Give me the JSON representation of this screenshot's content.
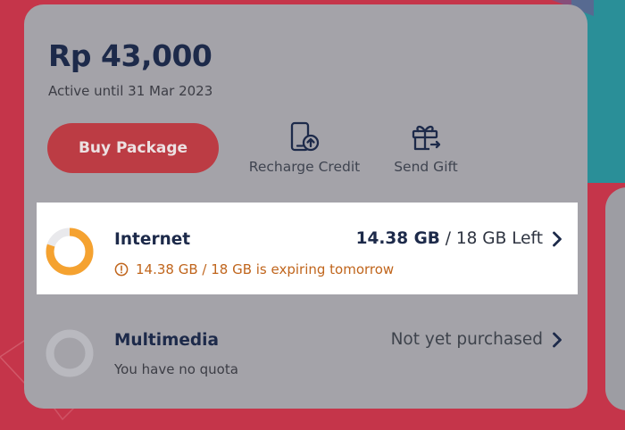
{
  "balance": {
    "amount": "Rp 43,000",
    "active_until": "Active until 31 Mar 2023"
  },
  "actions": {
    "buy_package": "Buy Package",
    "recharge_credit": "Recharge Credit",
    "send_gift": "Send Gift"
  },
  "quotas": {
    "internet": {
      "title": "Internet",
      "used": "14.38 GB",
      "total": "/ 18 GB Left",
      "note": "14.38 GB / 18 GB is expiring tomorrow",
      "remaining_fraction": 0.8
    },
    "multimedia": {
      "title": "Multimedia",
      "status": "Not yet purchased",
      "note": "You have no quota"
    }
  },
  "colors": {
    "background": "#c5354a",
    "card": "#a4a3a9",
    "brand_red": "#bc3c44",
    "ring_orange": "#f5a230",
    "warning": "#c0651c",
    "navy_text": "#1d2a4a"
  },
  "icons": {
    "recharge": "phone-upload-icon",
    "gift": "gift-icon",
    "chevron": "chevron-right-icon",
    "warning": "alert-circle-icon"
  }
}
